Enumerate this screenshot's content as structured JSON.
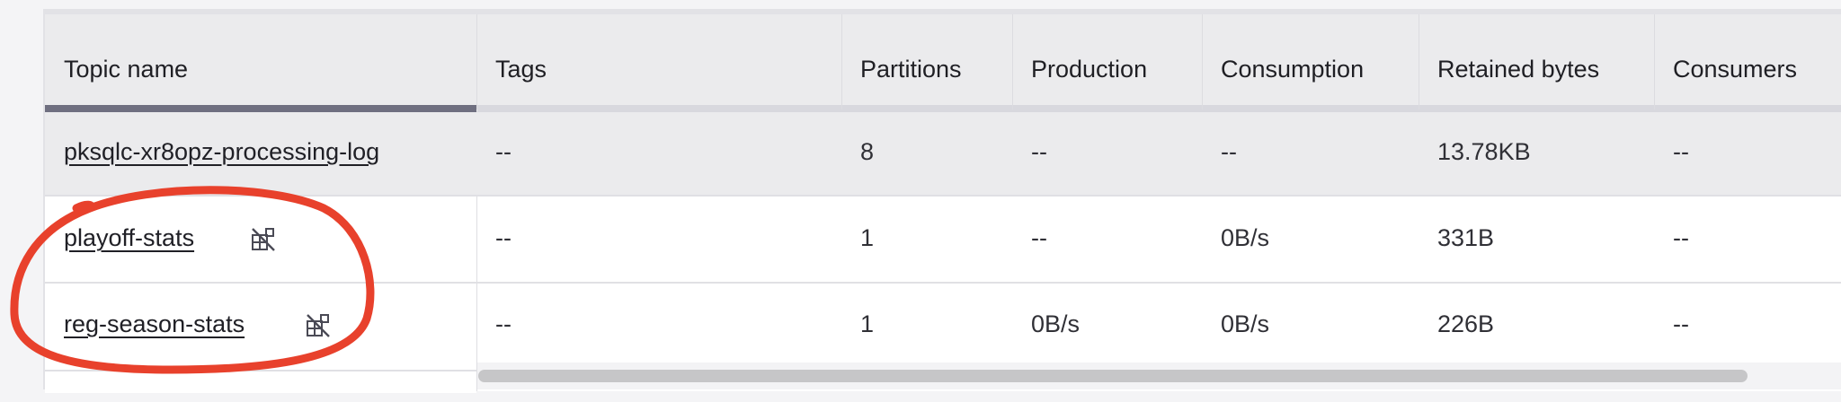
{
  "table": {
    "headers": {
      "topic_name": "Topic name",
      "tags": "Tags",
      "partitions": "Partitions",
      "production": "Production",
      "consumption": "Consumption",
      "retained_bytes": "Retained bytes",
      "consumers": "Consumers"
    },
    "rows": [
      {
        "topic": "pksqlc-xr8opz-processing-log",
        "tags": "--",
        "partitions": "8",
        "production": "--",
        "consumption": "--",
        "retained_bytes": "13.78KB",
        "consumers": "--",
        "icon": null
      },
      {
        "topic": "playoff-stats",
        "tags": "--",
        "partitions": "1",
        "production": "--",
        "consumption": "0B/s",
        "retained_bytes": "331B",
        "consumers": "--",
        "icon": "no-schema-icon"
      },
      {
        "topic": "reg-season-stats",
        "tags": "--",
        "partitions": "1",
        "production": "0B/s",
        "consumption": "0B/s",
        "retained_bytes": "226B",
        "consumers": "--",
        "icon": "no-schema-icon"
      }
    ]
  },
  "colors": {
    "annotation": "#e8412c",
    "header_bg": "#ebebed",
    "active_bar": "#6f6f80"
  }
}
